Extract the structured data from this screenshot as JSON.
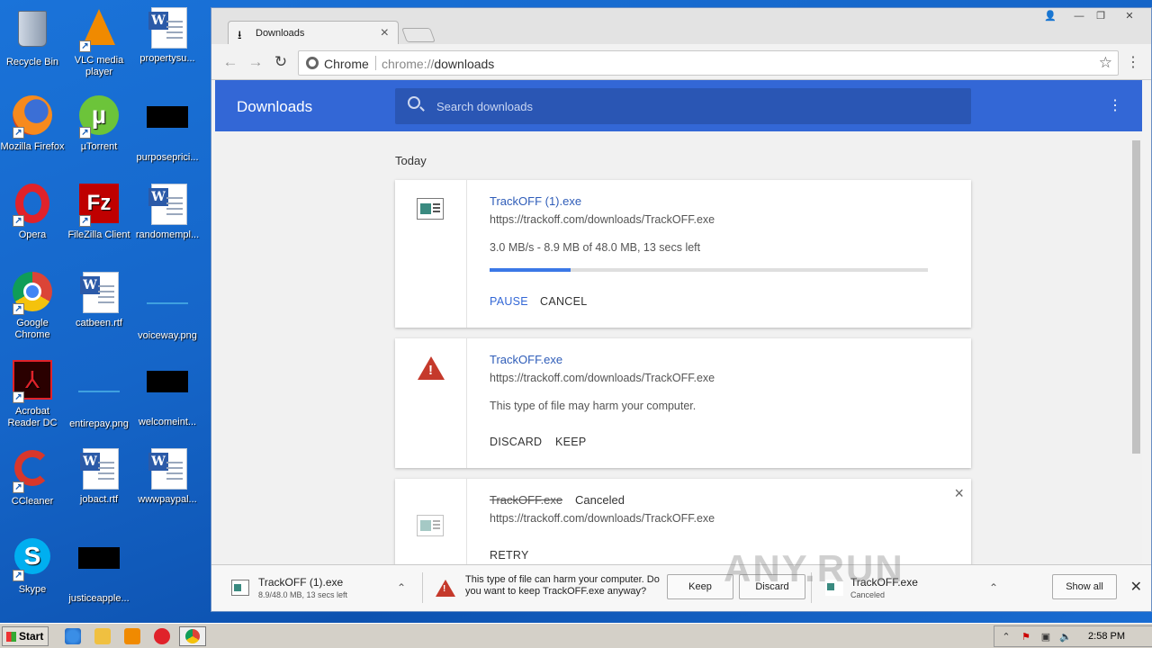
{
  "desktop": {
    "icons": [
      {
        "label": "Recycle Bin"
      },
      {
        "label": "VLC media player"
      },
      {
        "label": "propertysu..."
      },
      {
        "label": "Mozilla Firefox"
      },
      {
        "label": "µTorrent"
      },
      {
        "label": "purposeprici..."
      },
      {
        "label": "Opera"
      },
      {
        "label": "FileZilla Client"
      },
      {
        "label": "randomempl..."
      },
      {
        "label": "Google Chrome"
      },
      {
        "label": "catbeen.rtf"
      },
      {
        "label": "voiceway.png"
      },
      {
        "label": "Acrobat Reader DC"
      },
      {
        "label": "entirepay.png"
      },
      {
        "label": "welcomeint..."
      },
      {
        "label": "CCleaner"
      },
      {
        "label": "jobact.rtf"
      },
      {
        "label": "wwwpaypal..."
      },
      {
        "label": "Skype"
      },
      {
        "label": "justiceapple..."
      }
    ]
  },
  "browser": {
    "tab_title": "Downloads",
    "omnibox_label": "Chrome",
    "url_scheme": "chrome://",
    "url_path": "downloads"
  },
  "downloads_page": {
    "title": "Downloads",
    "search_placeholder": "Search downloads",
    "section_label": "Today",
    "items": [
      {
        "filename": "TrackOFF (1).exe",
        "url": "https://trackoff.com/downloads/TrackOFF.exe",
        "status": "3.0 MB/s - 8.9 MB of 48.0 MB, 13 secs left",
        "progress": 0.185,
        "actions": [
          "PAUSE",
          "CANCEL"
        ]
      },
      {
        "filename": "TrackOFF.exe",
        "url": "https://trackoff.com/downloads/TrackOFF.exe",
        "status": "This type of file may harm your computer.",
        "actions": [
          "DISCARD",
          "KEEP"
        ]
      },
      {
        "filename": "TrackOFF.exe",
        "state": "Canceled",
        "url": "https://trackoff.com/downloads/TrackOFF.exe",
        "actions": [
          "RETRY"
        ]
      }
    ]
  },
  "shelf": {
    "item1_name": "TrackOFF (1).exe",
    "item1_sub": "8.9/48.0 MB, 13 secs left",
    "warning_text": "This type of file can harm your computer. Do you want to keep TrackOFF.exe anyway?",
    "keep_label": "Keep",
    "discard_label": "Discard",
    "item3_name": "TrackOFF.exe",
    "item3_sub": "Canceled",
    "show_all_label": "Show all"
  },
  "watermark": "ANY.RUN",
  "taskbar": {
    "start_label": "Start",
    "time": "2:58 PM"
  }
}
